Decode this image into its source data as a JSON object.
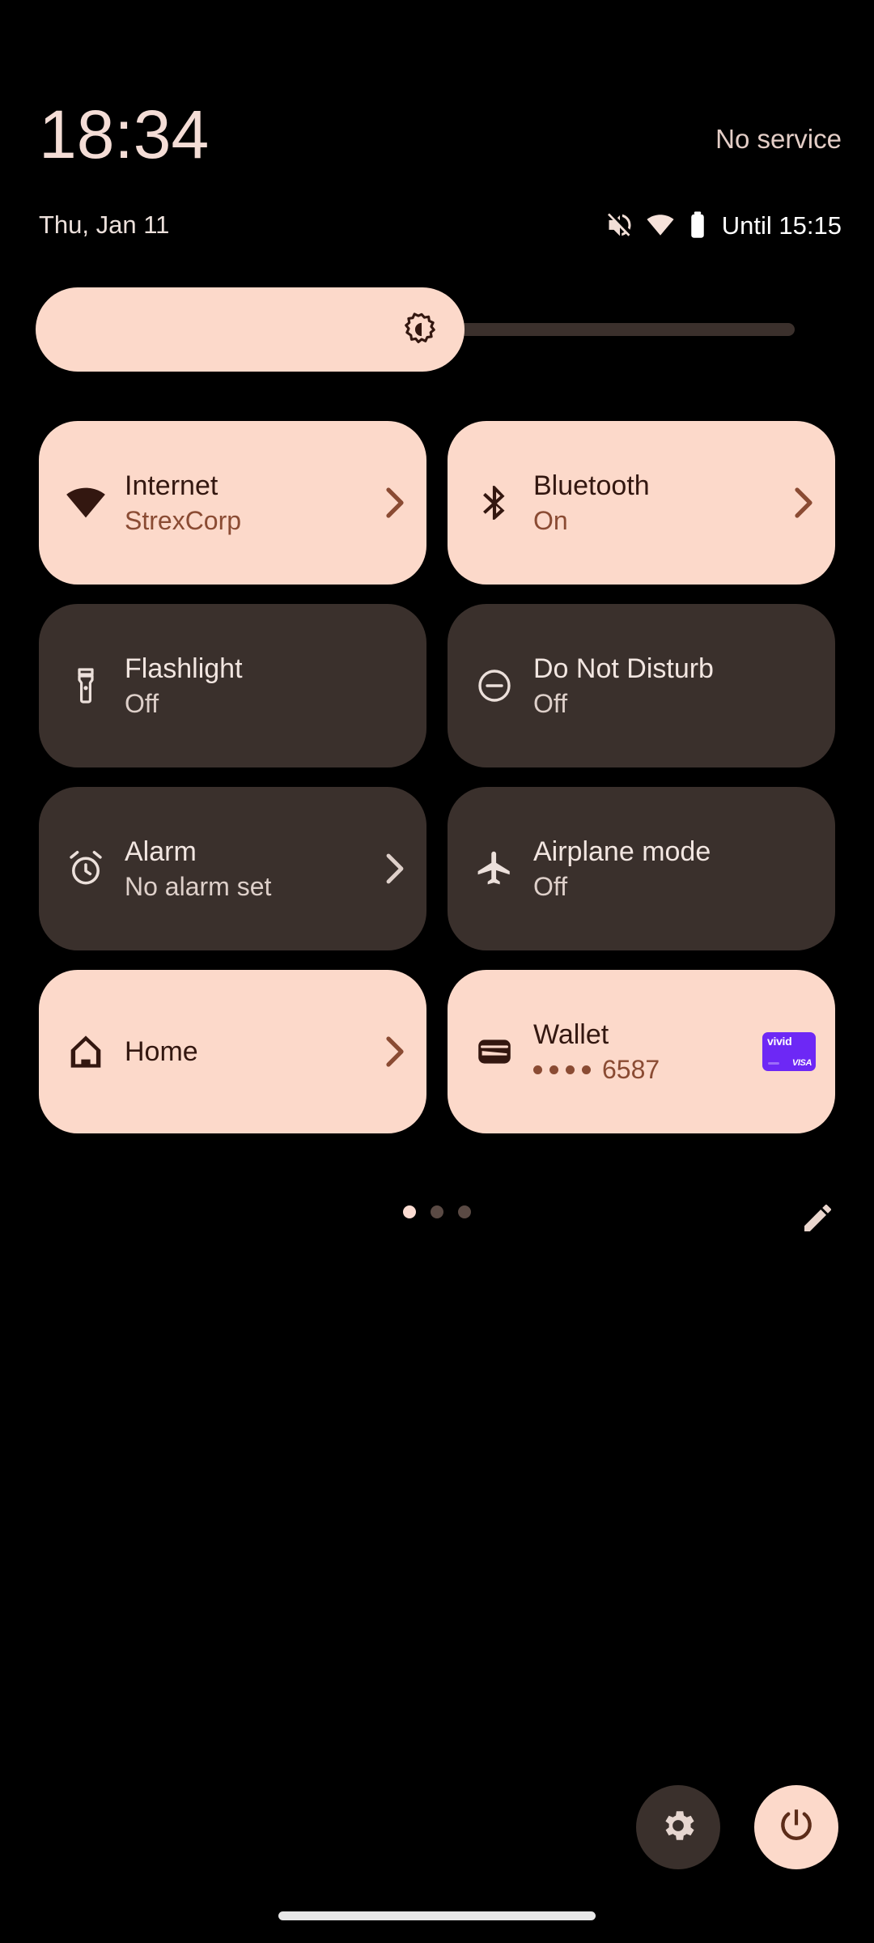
{
  "statusbar": {
    "clock": "18:34",
    "carrier": "No service",
    "date": "Thu, Jan 11",
    "battery_text": "Until 15:15",
    "icons": [
      "volume-mute-icon",
      "wifi-icon",
      "battery-icon"
    ]
  },
  "brightness": {
    "icon": "brightness-icon",
    "level_percent": 56,
    "fill_color": "#fcd9ca",
    "track_color": "#3b302c"
  },
  "tiles": [
    {
      "name": "internet",
      "icon": "wifi-icon",
      "title": "Internet",
      "subtitle": "StrexCorp",
      "state": "active",
      "has_chevron": true
    },
    {
      "name": "bluetooth",
      "icon": "bluetooth-icon",
      "title": "Bluetooth",
      "subtitle": "On",
      "state": "active",
      "has_chevron": true
    },
    {
      "name": "flashlight",
      "icon": "flashlight-icon",
      "title": "Flashlight",
      "subtitle": "Off",
      "state": "inactive",
      "has_chevron": false
    },
    {
      "name": "do-not-disturb",
      "icon": "do-not-disturb-icon",
      "title": "Do Not Disturb",
      "subtitle": "Off",
      "state": "inactive",
      "has_chevron": false
    },
    {
      "name": "alarm",
      "icon": "alarm-clock-icon",
      "title": "Alarm",
      "subtitle": "No alarm set",
      "state": "inactive",
      "has_chevron": true
    },
    {
      "name": "airplane-mode",
      "icon": "airplane-icon",
      "title": "Airplane mode",
      "subtitle": "Off",
      "state": "inactive",
      "has_chevron": false
    },
    {
      "name": "home",
      "icon": "home-icon",
      "title": "Home",
      "subtitle": "",
      "state": "active",
      "has_chevron": true
    },
    {
      "name": "wallet",
      "icon": "wallet-icon",
      "title": "Wallet",
      "subtitle": "6587",
      "state": "active",
      "has_chevron": false,
      "card": {
        "brand": "vivid",
        "network": "VISA",
        "color": "#6d28f5"
      }
    }
  ],
  "pager": {
    "page_count": 3,
    "active_page": 1,
    "edit_icon": "pencil-edit-icon"
  },
  "footer": {
    "settings_icon": "gear-icon",
    "power_icon": "power-icon"
  },
  "colors": {
    "background": "#000000",
    "tile_active": "#fcd9ca",
    "tile_inactive": "#3a302c",
    "accent_text": "#8a4b33",
    "title_on_active": "#331710",
    "title_on_inactive": "#f2e6e1"
  }
}
